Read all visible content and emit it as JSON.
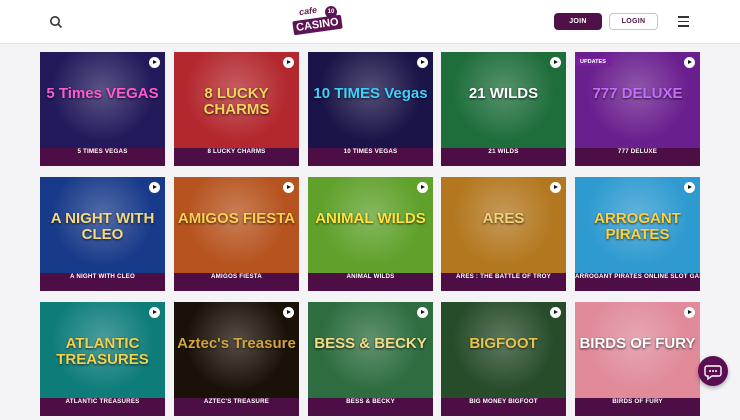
{
  "header": {
    "logo_top": "cafe",
    "logo_main": "CASINO",
    "logo_badge": "10",
    "join_label": "JOIN",
    "login_label": "LOGIN"
  },
  "ribbon": "UPDATES",
  "games": [
    {
      "label": "5 TIMES VEGAS",
      "art": "5 Times VEGAS",
      "bg": "#231a5c",
      "art_color": "#ff5ad6"
    },
    {
      "label": "8 LUCKY CHARMS",
      "art": "8 LUCKY CHARMS",
      "bg": "#b3282e",
      "art_color": "#f6d35b"
    },
    {
      "label": "10 TIMES VEGAS",
      "art": "10 TIMES Vegas",
      "bg": "#1a1448",
      "art_color": "#3fd0ff"
    },
    {
      "label": "21 WILDS",
      "art": "21 WILDS",
      "bg": "#1e6e3b",
      "art_color": "#ffffff"
    },
    {
      "label": "777 DELUXE",
      "art": "777 DELUXE",
      "bg": "#6a1f8e",
      "art_color": "#c86cff"
    },
    {
      "label": "A NIGHT WITH CLEO",
      "art": "A NIGHT WITH CLEO",
      "bg": "#183a8a",
      "art_color": "#f5d983"
    },
    {
      "label": "AMIGOS FIESTA",
      "art": "AMIGOS FIESTA",
      "bg": "#b6531e",
      "art_color": "#ffd050"
    },
    {
      "label": "ANIMAL WILDS",
      "art": "ANIMAL WILDS",
      "bg": "#5fa12b",
      "art_color": "#ffe23a"
    },
    {
      "label": "ARES : THE BATTLE OF TROY",
      "art": "ARES",
      "bg": "#b3771f",
      "art_color": "#f3d37a"
    },
    {
      "label": "ARROGANT PIRATES ONLINE SLOT GAME",
      "art": "ARROGANT PIRATES",
      "bg": "#2e9ad0",
      "art_color": "#ffd23a"
    },
    {
      "label": "ATLANTIC TREASURES",
      "art": "ATLANTIC TREASURES",
      "bg": "#0e7d7a",
      "art_color": "#f4d24c"
    },
    {
      "label": "AZTEC'S TREASURE",
      "art": "Aztec's Treasure",
      "bg": "#1a1208",
      "art_color": "#d5a33c"
    },
    {
      "label": "BESS & BECKY",
      "art": "BESS & BECKY",
      "bg": "#2d6d3f",
      "art_color": "#f3dc8a"
    },
    {
      "label": "BIG MONEY BIGFOOT",
      "art": "BIGFOOT",
      "bg": "#274c2a",
      "art_color": "#e8c24a"
    },
    {
      "label": "BIRDS OF FURY",
      "art": "BIRDS OF FURY",
      "bg": "#e08a9a",
      "art_color": "#ffffff"
    }
  ]
}
